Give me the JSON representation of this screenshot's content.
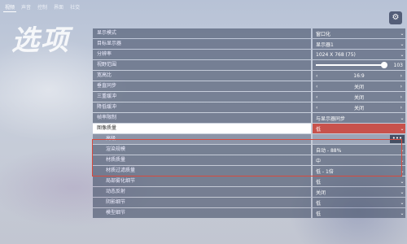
{
  "nav": {
    "tabs": [
      "视频",
      "声音",
      "控制",
      "界面",
      "社交"
    ]
  },
  "title": "选项",
  "rows": [
    {
      "label": "显示模式",
      "type": "dd",
      "value": "窗口化"
    },
    {
      "label": "目标显示器",
      "type": "dd",
      "value": "显示器1"
    },
    {
      "label": "分辨率",
      "type": "dd",
      "value": "1024 X 768 (75)"
    },
    {
      "label": "视野范围",
      "type": "slider",
      "value": "103"
    },
    {
      "label": "宽高比",
      "type": "sel",
      "value": "16:9"
    },
    {
      "label": "垂直同步",
      "type": "sel",
      "value": "关闭"
    },
    {
      "label": "三重缓冲",
      "type": "sel",
      "value": "关闭"
    },
    {
      "label": "降低缓冲",
      "type": "sel",
      "value": "关闭"
    },
    {
      "label": "帧率限制",
      "type": "dd",
      "value": "与显示器同步"
    },
    {
      "label": "图像质量",
      "type": "dd",
      "value": "低",
      "highlight": true
    },
    {
      "label": "高级",
      "type": "input",
      "value": "",
      "gray": true,
      "sub": true
    },
    {
      "label": "渲染规模",
      "type": "dd",
      "value": "自动 - 88%",
      "sub": true
    },
    {
      "label": "材质质量",
      "type": "dd",
      "value": "中",
      "sub": true
    },
    {
      "label": "材质过滤质量",
      "type": "dd",
      "value": "低 - 1倍",
      "sub": true
    },
    {
      "label": "局部雾化细节",
      "type": "dd",
      "value": "低",
      "sub": true
    },
    {
      "label": "动态反射",
      "type": "dd",
      "value": "关闭",
      "sub": true
    },
    {
      "label": "阴影细节",
      "type": "dd",
      "value": "低",
      "sub": true
    },
    {
      "label": "模型细节",
      "type": "dd",
      "value": "低",
      "sub": true
    }
  ]
}
